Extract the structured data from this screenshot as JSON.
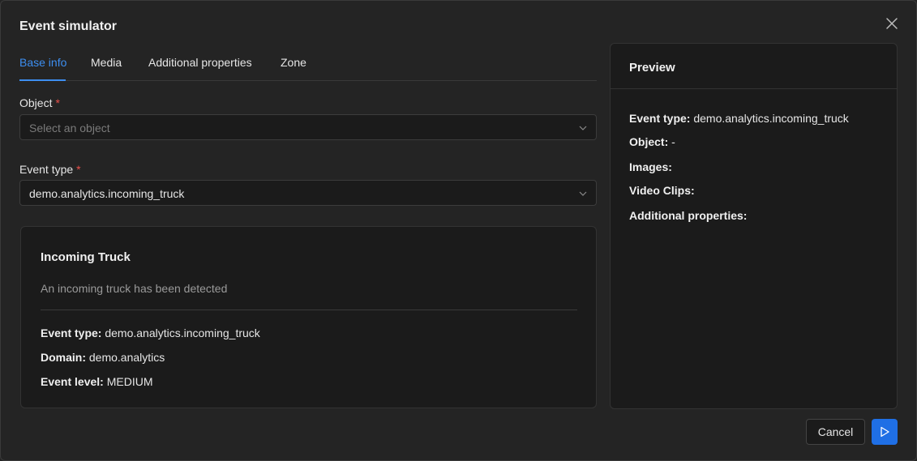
{
  "dialog": {
    "title": "Event simulator"
  },
  "tabs": [
    {
      "label": "Base info",
      "active": true
    },
    {
      "label": "Media",
      "active": false
    },
    {
      "label": "Additional properties",
      "active": false
    },
    {
      "label": "Zone",
      "active": false
    }
  ],
  "form": {
    "object": {
      "label": "Object",
      "required_mark": "*",
      "placeholder": "Select an object",
      "value": ""
    },
    "event_type": {
      "label": "Event type",
      "required_mark": "*",
      "value": "demo.analytics.incoming_truck"
    }
  },
  "event_info": {
    "title": "Incoming Truck",
    "description": "An incoming truck has been detected",
    "rows": [
      {
        "key": "Event type:",
        "value": "demo.analytics.incoming_truck"
      },
      {
        "key": "Domain:",
        "value": "demo.analytics"
      },
      {
        "key": "Event level:",
        "value": "MEDIUM"
      }
    ]
  },
  "preview": {
    "title": "Preview",
    "rows": [
      {
        "key": "Event type:",
        "value": "demo.analytics.incoming_truck"
      },
      {
        "key": "Object:",
        "value": "-"
      },
      {
        "key": "Images:",
        "value": ""
      },
      {
        "key": "Video Clips:",
        "value": ""
      },
      {
        "key": "Additional properties:",
        "value": ""
      }
    ]
  },
  "footer": {
    "cancel_label": "Cancel",
    "run_icon": "play-icon"
  },
  "colors": {
    "accent": "#3d8ef0",
    "primary_button": "#1f6fe5",
    "required": "#e8504b",
    "background": "#242424",
    "panel": "#1b1b1b"
  }
}
